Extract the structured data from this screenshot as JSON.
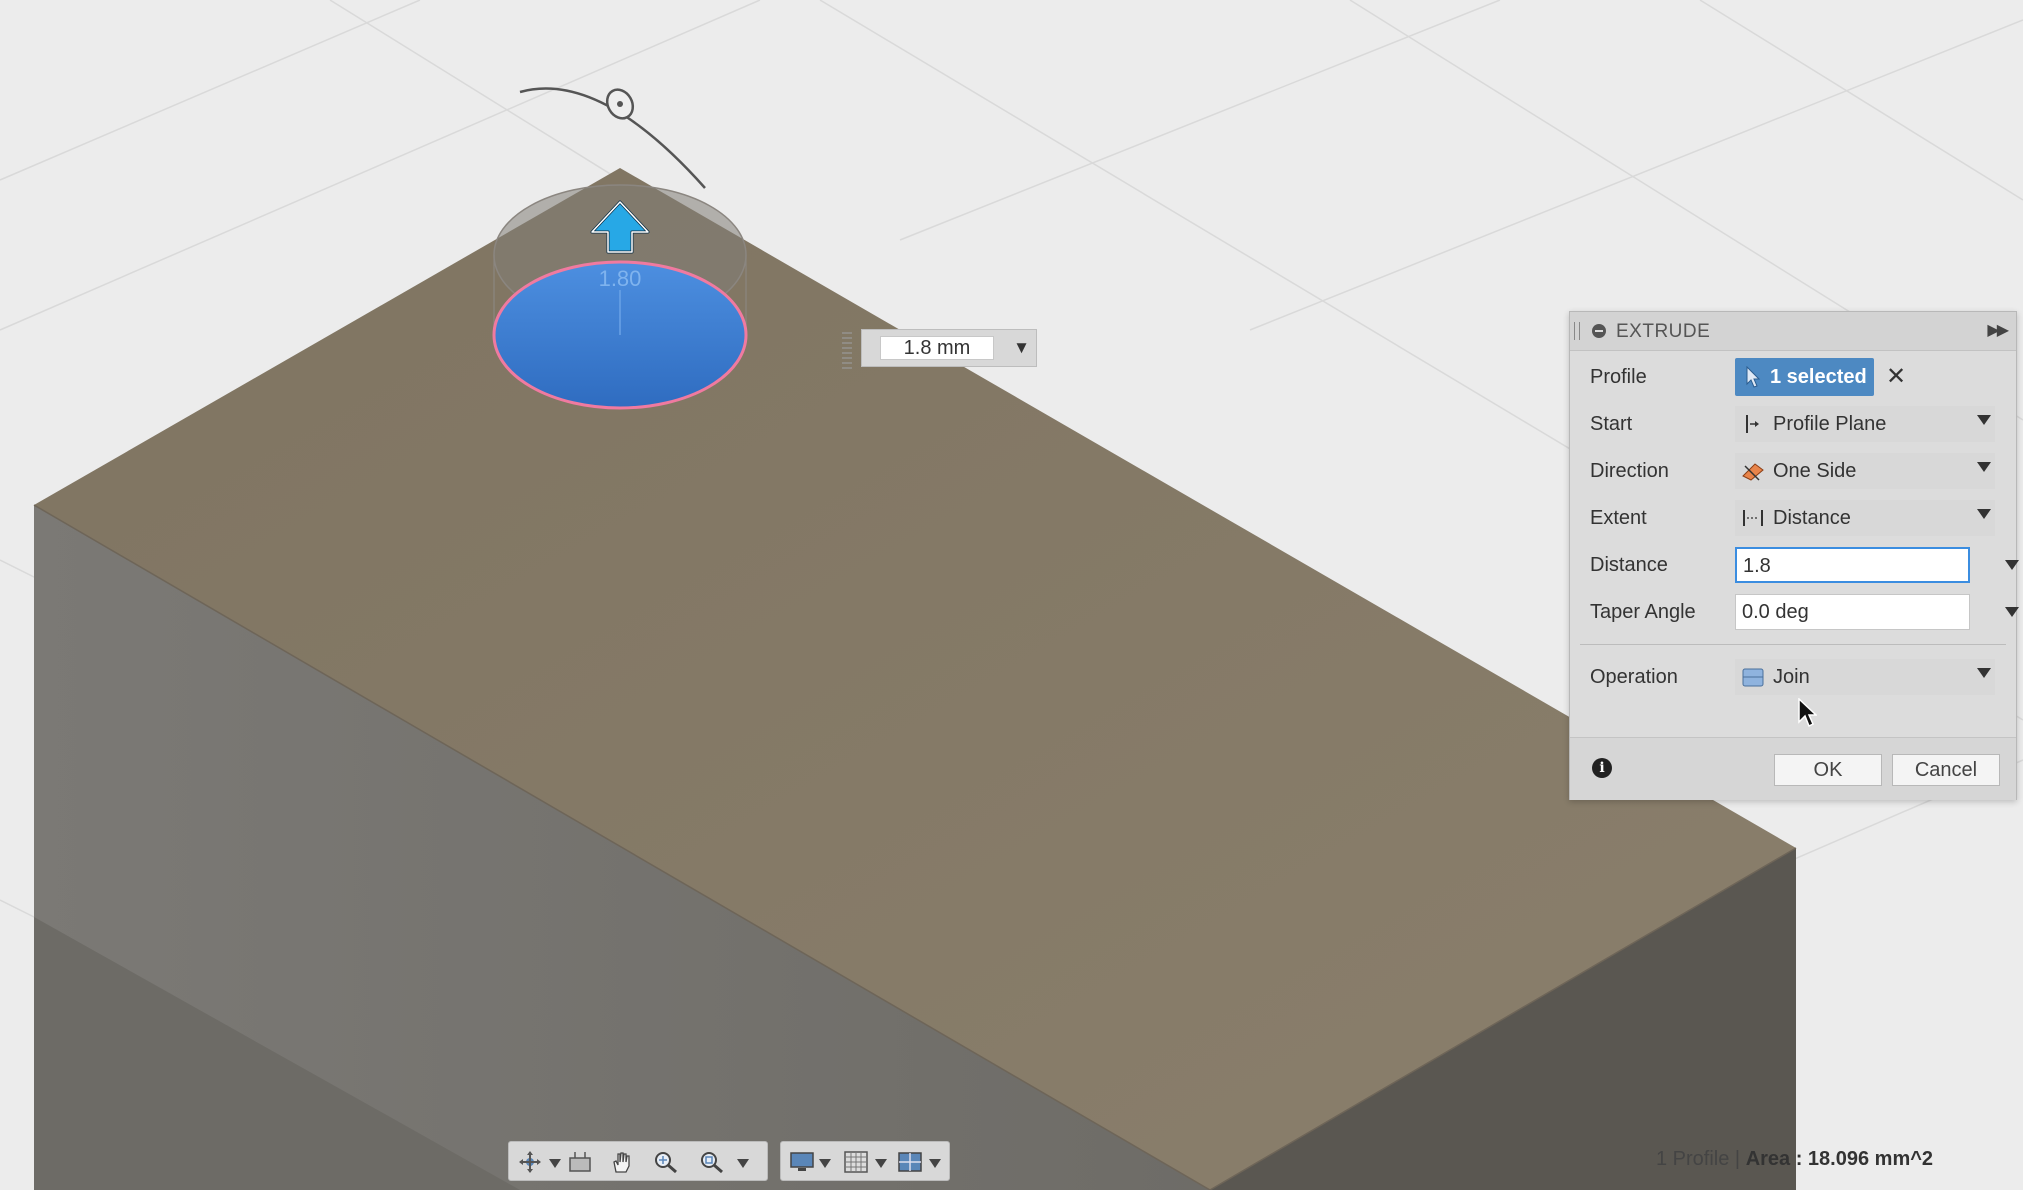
{
  "viewport": {
    "dimension_label": "1.80",
    "manipulator_value": "1.8 mm",
    "colors": {
      "background": "#ececec",
      "block_top": "#857a68",
      "block_left": "#76746f",
      "block_right": "#595650",
      "profile_fill": "#3f7fd0",
      "profile_outline": "#f07aa0",
      "arrow": "#27a8e6"
    }
  },
  "dialog": {
    "title": "EXTRUDE",
    "rows": {
      "profile": {
        "label": "Profile",
        "value": "1 selected"
      },
      "start": {
        "label": "Start",
        "value": "Profile Plane",
        "icon": "profile-plane-icon"
      },
      "direction": {
        "label": "Direction",
        "value": "One Side",
        "icon": "one-side-icon"
      },
      "extent": {
        "label": "Extent",
        "value": "Distance",
        "icon": "distance-icon"
      },
      "distance": {
        "label": "Distance",
        "value": "1.8"
      },
      "taper": {
        "label": "Taper Angle",
        "value": "0.0 deg"
      },
      "operation": {
        "label": "Operation",
        "value": "Join",
        "icon": "join-icon"
      }
    },
    "buttons": {
      "ok": "OK",
      "cancel": "Cancel"
    },
    "accent": "#4d89c2"
  },
  "toolbar": {
    "icons": [
      "orbit-icon",
      "look-at-icon",
      "pan-icon",
      "zoom-icon",
      "fit-icon",
      "display-settings-icon",
      "grid-icon",
      "viewports-icon"
    ]
  },
  "status": {
    "profile_count": "1 Profile",
    "separator": " | ",
    "area_label": "Area : 18.096 mm^2"
  }
}
